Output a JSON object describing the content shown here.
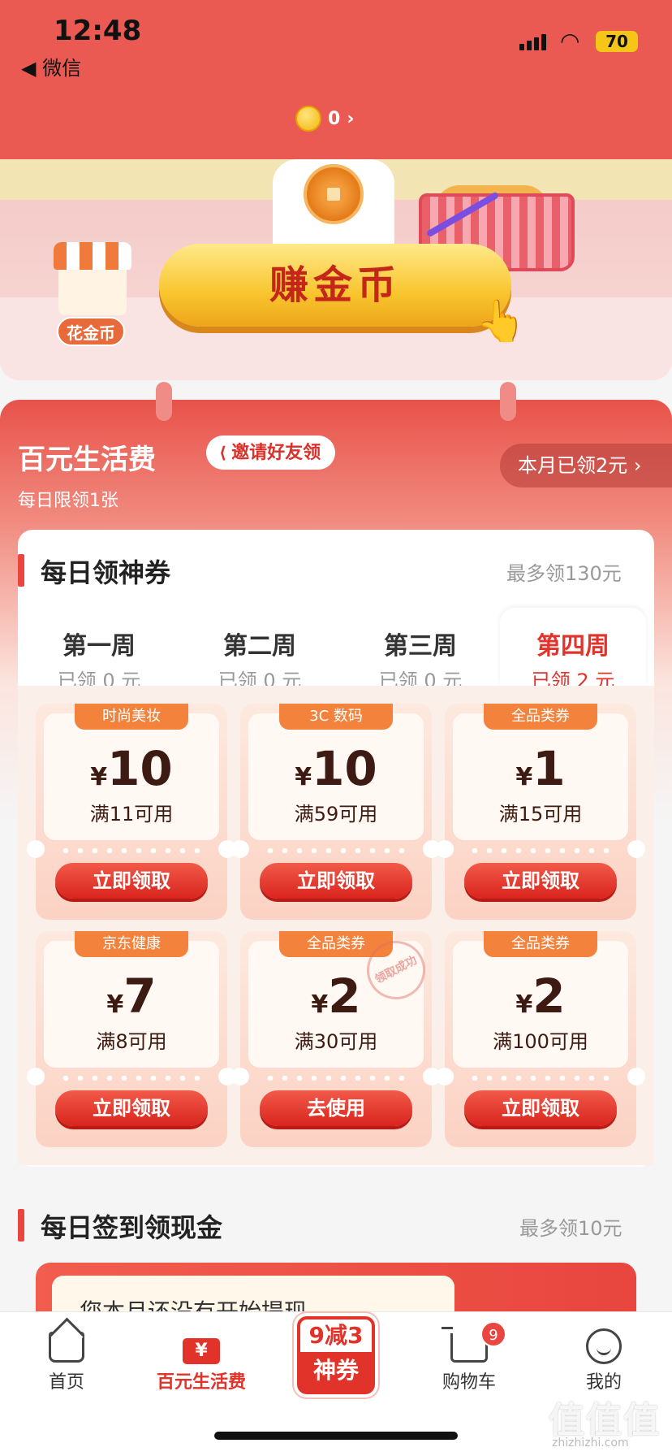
{
  "status_bar": {
    "time": "12:48",
    "back_label": "◀ 微信",
    "battery": "70"
  },
  "header": {
    "coin_count": "0",
    "chevron": "›"
  },
  "hero": {
    "shop_label": "花金币",
    "earn_button": "赚金币"
  },
  "panel": {
    "title": "百元生活费",
    "subtitle": "每日限领1张",
    "invite_label": "邀请好友领",
    "month_claimed": "本月已领2元 ›"
  },
  "daily_coupons": {
    "title": "每日领神券",
    "max_text": "最多领130元",
    "weeks": [
      {
        "name": "第一周",
        "claimed": "已领 0 元",
        "active": false
      },
      {
        "name": "第二周",
        "claimed": "已领 0 元",
        "active": false
      },
      {
        "name": "第三周",
        "claimed": "已领 0 元",
        "active": false
      },
      {
        "name": "第四周",
        "claimed": "已领 2 元",
        "active": true
      }
    ],
    "coupons": [
      {
        "tag": "时尚美妆",
        "yen": "¥",
        "amount": "10",
        "condition": "满11可用",
        "button": "立即领取"
      },
      {
        "tag": "3C 数码",
        "yen": "¥",
        "amount": "10",
        "condition": "满59可用",
        "button": "立即领取"
      },
      {
        "tag": "全品类券",
        "yen": "¥",
        "amount": "1",
        "condition": "满15可用",
        "button": "立即领取"
      },
      {
        "tag": "京东健康",
        "yen": "¥",
        "amount": "7",
        "condition": "满8可用",
        "button": "立即领取"
      },
      {
        "tag": "全品类券",
        "yen": "¥",
        "amount": "2",
        "condition": "满30可用",
        "button": "去使用",
        "stamp": "领取成功"
      },
      {
        "tag": "全品类券",
        "yen": "¥",
        "amount": "2",
        "condition": "满100可用",
        "button": "立即领取"
      }
    ]
  },
  "daily_signin": {
    "title": "每日签到领现金",
    "max_text": "最多领10元",
    "inner_text": "您本月还没有开始提现"
  },
  "bottom_nav": {
    "home": "首页",
    "ticket_glyph": "¥",
    "life_fee": "百元生活费",
    "promo_top": "9减3",
    "promo_bottom": "神券",
    "cart": "购物车",
    "cart_badge": "9",
    "me": "我的"
  },
  "watermark": {
    "main": "值值值",
    "sub": "zhizhizhi.com"
  },
  "colors": {
    "brand_red": "#e2332b",
    "header_red": "#ea5a53",
    "coupon_tag": "#f3833c",
    "gold": "#f8c52e"
  }
}
